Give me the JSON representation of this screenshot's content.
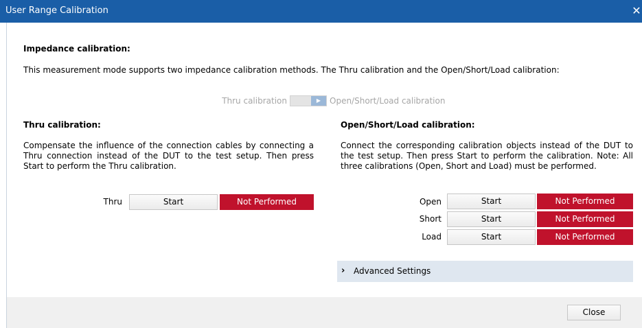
{
  "window": {
    "title": "User Range Calibration",
    "close_glyph": "✕"
  },
  "impedance": {
    "heading": "Impedance calibration:",
    "description": "This measurement mode supports two impedance calibration methods. The Thru calibration and the Open/Short/Load calibration:"
  },
  "toggle": {
    "left_label": "Thru calibration",
    "right_label": "Open/Short/Load calibration",
    "knob_glyph": "▶",
    "selected": "right"
  },
  "thru": {
    "heading": "Thru calibration:",
    "description": "Compensate the influence of the connection cables by connecting a Thru connection instead of the DUT to the test setup. Then press Start to perform the Thru calibration.",
    "rows": [
      {
        "label": "Thru",
        "button": "Start",
        "status": "Not Performed"
      }
    ]
  },
  "osl": {
    "heading": "Open/Short/Load calibration:",
    "description": "Connect the corresponding calibration objects instead of the DUT to the test setup. Then press Start to perform the calibration. Note: All three calibrations (Open, Short and Load) must be performed.",
    "rows": [
      {
        "label": "Open",
        "button": "Start",
        "status": "Not Performed"
      },
      {
        "label": "Short",
        "button": "Start",
        "status": "Not Performed"
      },
      {
        "label": "Load",
        "button": "Start",
        "status": "Not Performed"
      }
    ]
  },
  "advanced": {
    "chevron": "›",
    "label": "Advanced Settings"
  },
  "footer": {
    "close_label": "Close"
  },
  "colors": {
    "titlebar": "#1a5ea7",
    "status_red": "#c0122c",
    "advanced_bg": "#dfe7f0"
  }
}
